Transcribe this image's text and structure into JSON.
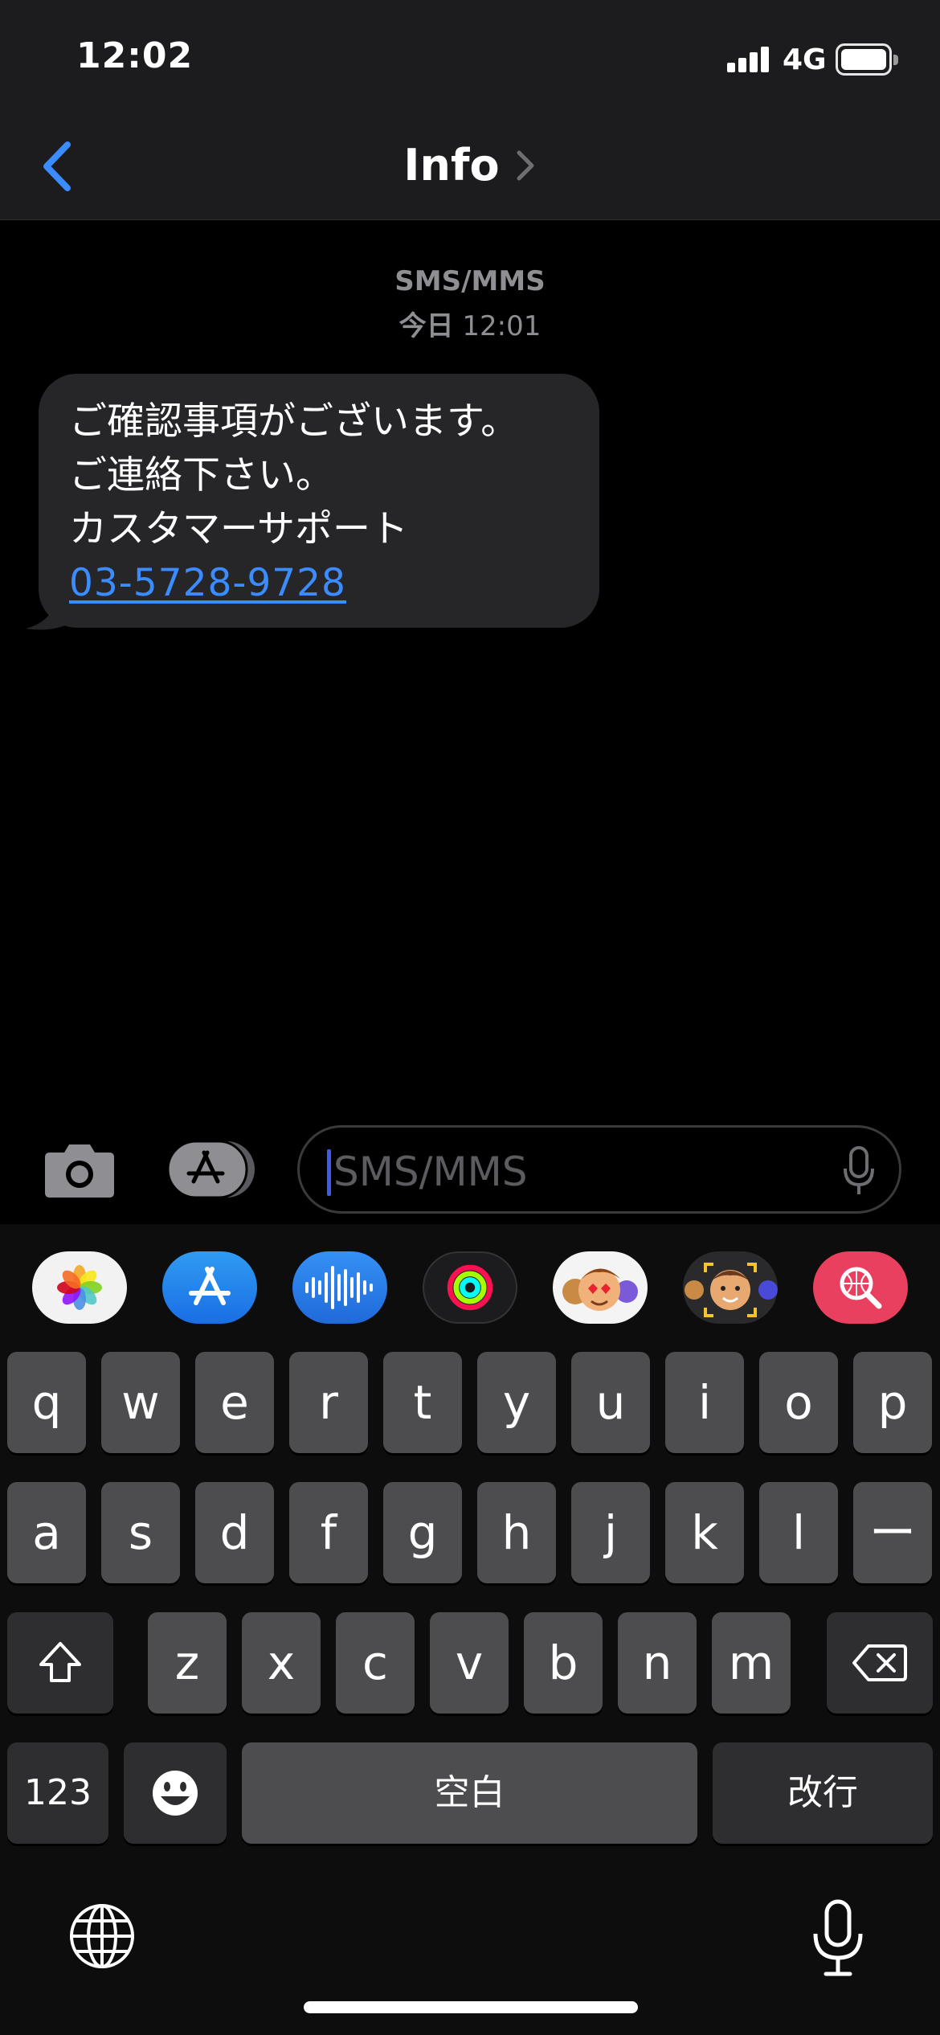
{
  "status_bar": {
    "time": "12:02",
    "network": "4G"
  },
  "nav": {
    "title": "Info"
  },
  "conversation": {
    "service": "SMS/MMS",
    "timestamp_day": "今日",
    "timestamp_time": "12:01",
    "message": {
      "lines": [
        "ご確認事項がございます。",
        "ご連絡下さい。",
        "カスタマーサポート"
      ],
      "phone_link": "03-5728-9728"
    }
  },
  "composer": {
    "placeholder": "SMS/MMS"
  },
  "app_drawer": [
    "photos-icon",
    "app-store-icon",
    "audio-message-icon",
    "fitness-icon",
    "memoji-stickers-icon",
    "memoji-icon",
    "image-search-icon"
  ],
  "keyboard": {
    "row1": [
      "q",
      "w",
      "e",
      "r",
      "t",
      "y",
      "u",
      "i",
      "o",
      "p"
    ],
    "row2": [
      "a",
      "s",
      "d",
      "f",
      "g",
      "h",
      "j",
      "k",
      "l",
      "ー"
    ],
    "row3": [
      "z",
      "x",
      "c",
      "v",
      "b",
      "n",
      "m"
    ],
    "numbers_key": "123",
    "space_key": "空白",
    "return_key": "改行"
  },
  "colors": {
    "link": "#3b8cff",
    "nav_back": "#3b8cff",
    "bubble": "#262629"
  }
}
